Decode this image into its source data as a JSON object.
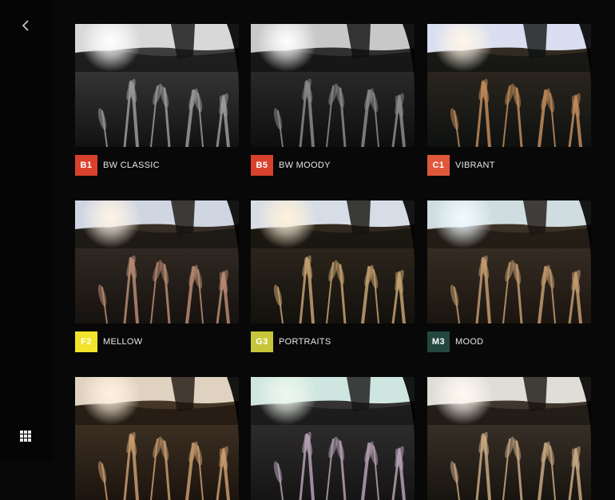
{
  "nav": {
    "back_icon": "chevron-left-icon",
    "grid_icon": "grid-icon"
  },
  "presets": [
    {
      "code": "B1",
      "name": "BW CLASSIC",
      "badge_color": "#d9412e",
      "badge_text_color": "#ffffff"
    },
    {
      "code": "B5",
      "name": "BW MOODY",
      "badge_color": "#d9412e",
      "badge_text_color": "#ffffff"
    },
    {
      "code": "C1",
      "name": "VIBRANT",
      "badge_color": "#e0583a",
      "badge_text_color": "#ffffff"
    },
    {
      "code": "F2",
      "name": "MELLOW",
      "badge_color": "#f2e32c",
      "badge_text_color": "#ffffff"
    },
    {
      "code": "G3",
      "name": "PORTRAITS",
      "badge_color": "#c7c63a",
      "badge_text_color": "#ffffff"
    },
    {
      "code": "M3",
      "name": "MOOD",
      "badge_color": "#23473f",
      "badge_text_color": "#ffffff"
    },
    {
      "code": "",
      "name": "",
      "badge_color": "#000000",
      "badge_text_color": "#ffffff"
    },
    {
      "code": "",
      "name": "",
      "badge_color": "#000000",
      "badge_text_color": "#ffffff"
    },
    {
      "code": "",
      "name": "",
      "badge_color": "#000000",
      "badge_text_color": "#ffffff"
    }
  ]
}
